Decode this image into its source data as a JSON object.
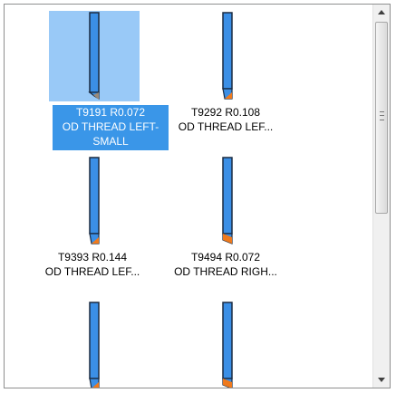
{
  "tools": [
    {
      "line1": "T9191 R0.072",
      "line2": "OD THREAD LEFT-",
      "line3": "SMALL",
      "selected": true
    },
    {
      "line1": "T9292 R0.108",
      "line2": "OD THREAD LEF...",
      "line3": "",
      "selected": false
    },
    {
      "line1": "T9393 R0.144",
      "line2": "OD THREAD LEF...",
      "line3": "",
      "selected": false
    },
    {
      "line1": "T9494 R0.072",
      "line2": "OD THREAD RIGH...",
      "line3": "",
      "selected": false
    },
    {
      "line1": "",
      "line2": "",
      "line3": "",
      "selected": false
    },
    {
      "line1": "",
      "line2": "",
      "line3": "",
      "selected": false
    }
  ],
  "colors": {
    "tool_body": "#3b8fe6",
    "tool_outline": "#1a2a40",
    "tool_tip": "#f07a1c",
    "selection_bg": "#99c9f7",
    "caption_selected_bg": "#3a96e8"
  },
  "icons": {
    "scroll_up": "triangle-up-icon",
    "scroll_down": "triangle-down-icon"
  }
}
